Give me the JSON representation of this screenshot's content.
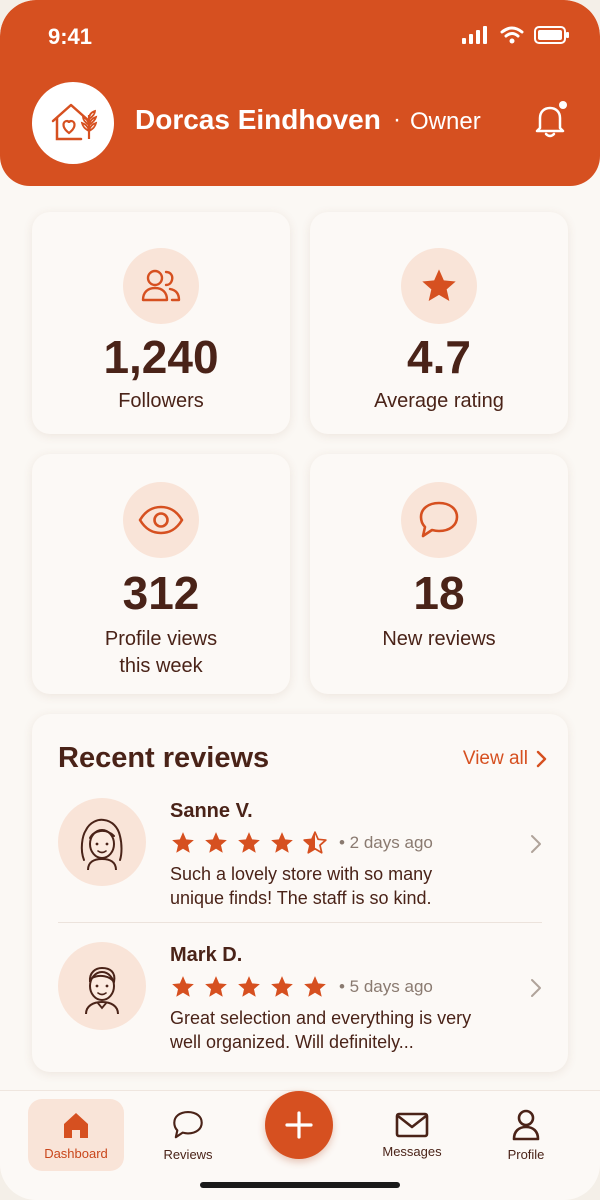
{
  "status_bar": {
    "time": "9:41"
  },
  "header": {
    "name": "Dorcas Eindhoven",
    "separator": "·",
    "role": "Owner"
  },
  "stats": [
    {
      "icon": "users-icon",
      "value": "1,240",
      "label": "Followers"
    },
    {
      "icon": "star-icon",
      "value": "4.7",
      "label": "Average rating"
    },
    {
      "icon": "eye-icon",
      "value": "312",
      "label_line1": "Profile views",
      "label_line2": "this week"
    },
    {
      "icon": "chat-bubble-icon",
      "value": "18",
      "label": "New reviews"
    }
  ],
  "reviews": {
    "title": "Recent reviews",
    "view_all": "View all",
    "items": [
      {
        "name": "Sanne V.",
        "rating": 4.5,
        "time": "• 2 days ago",
        "text": "Such a lovely store with so many unique finds! The staff is so kind."
      },
      {
        "name": "Mark D.",
        "rating": 5,
        "time": "• 5 days ago",
        "text": "Great selection and everything is very well organized. Will definitely..."
      }
    ]
  },
  "nav": {
    "dashboard": "Dashboard",
    "reviews": "Reviews",
    "messages": "Messages",
    "profile": "Profile"
  },
  "colors": {
    "accent": "#d65020",
    "accent_light": "#f9e4d8",
    "text": "#4a2318",
    "background": "#fbf8f4"
  }
}
